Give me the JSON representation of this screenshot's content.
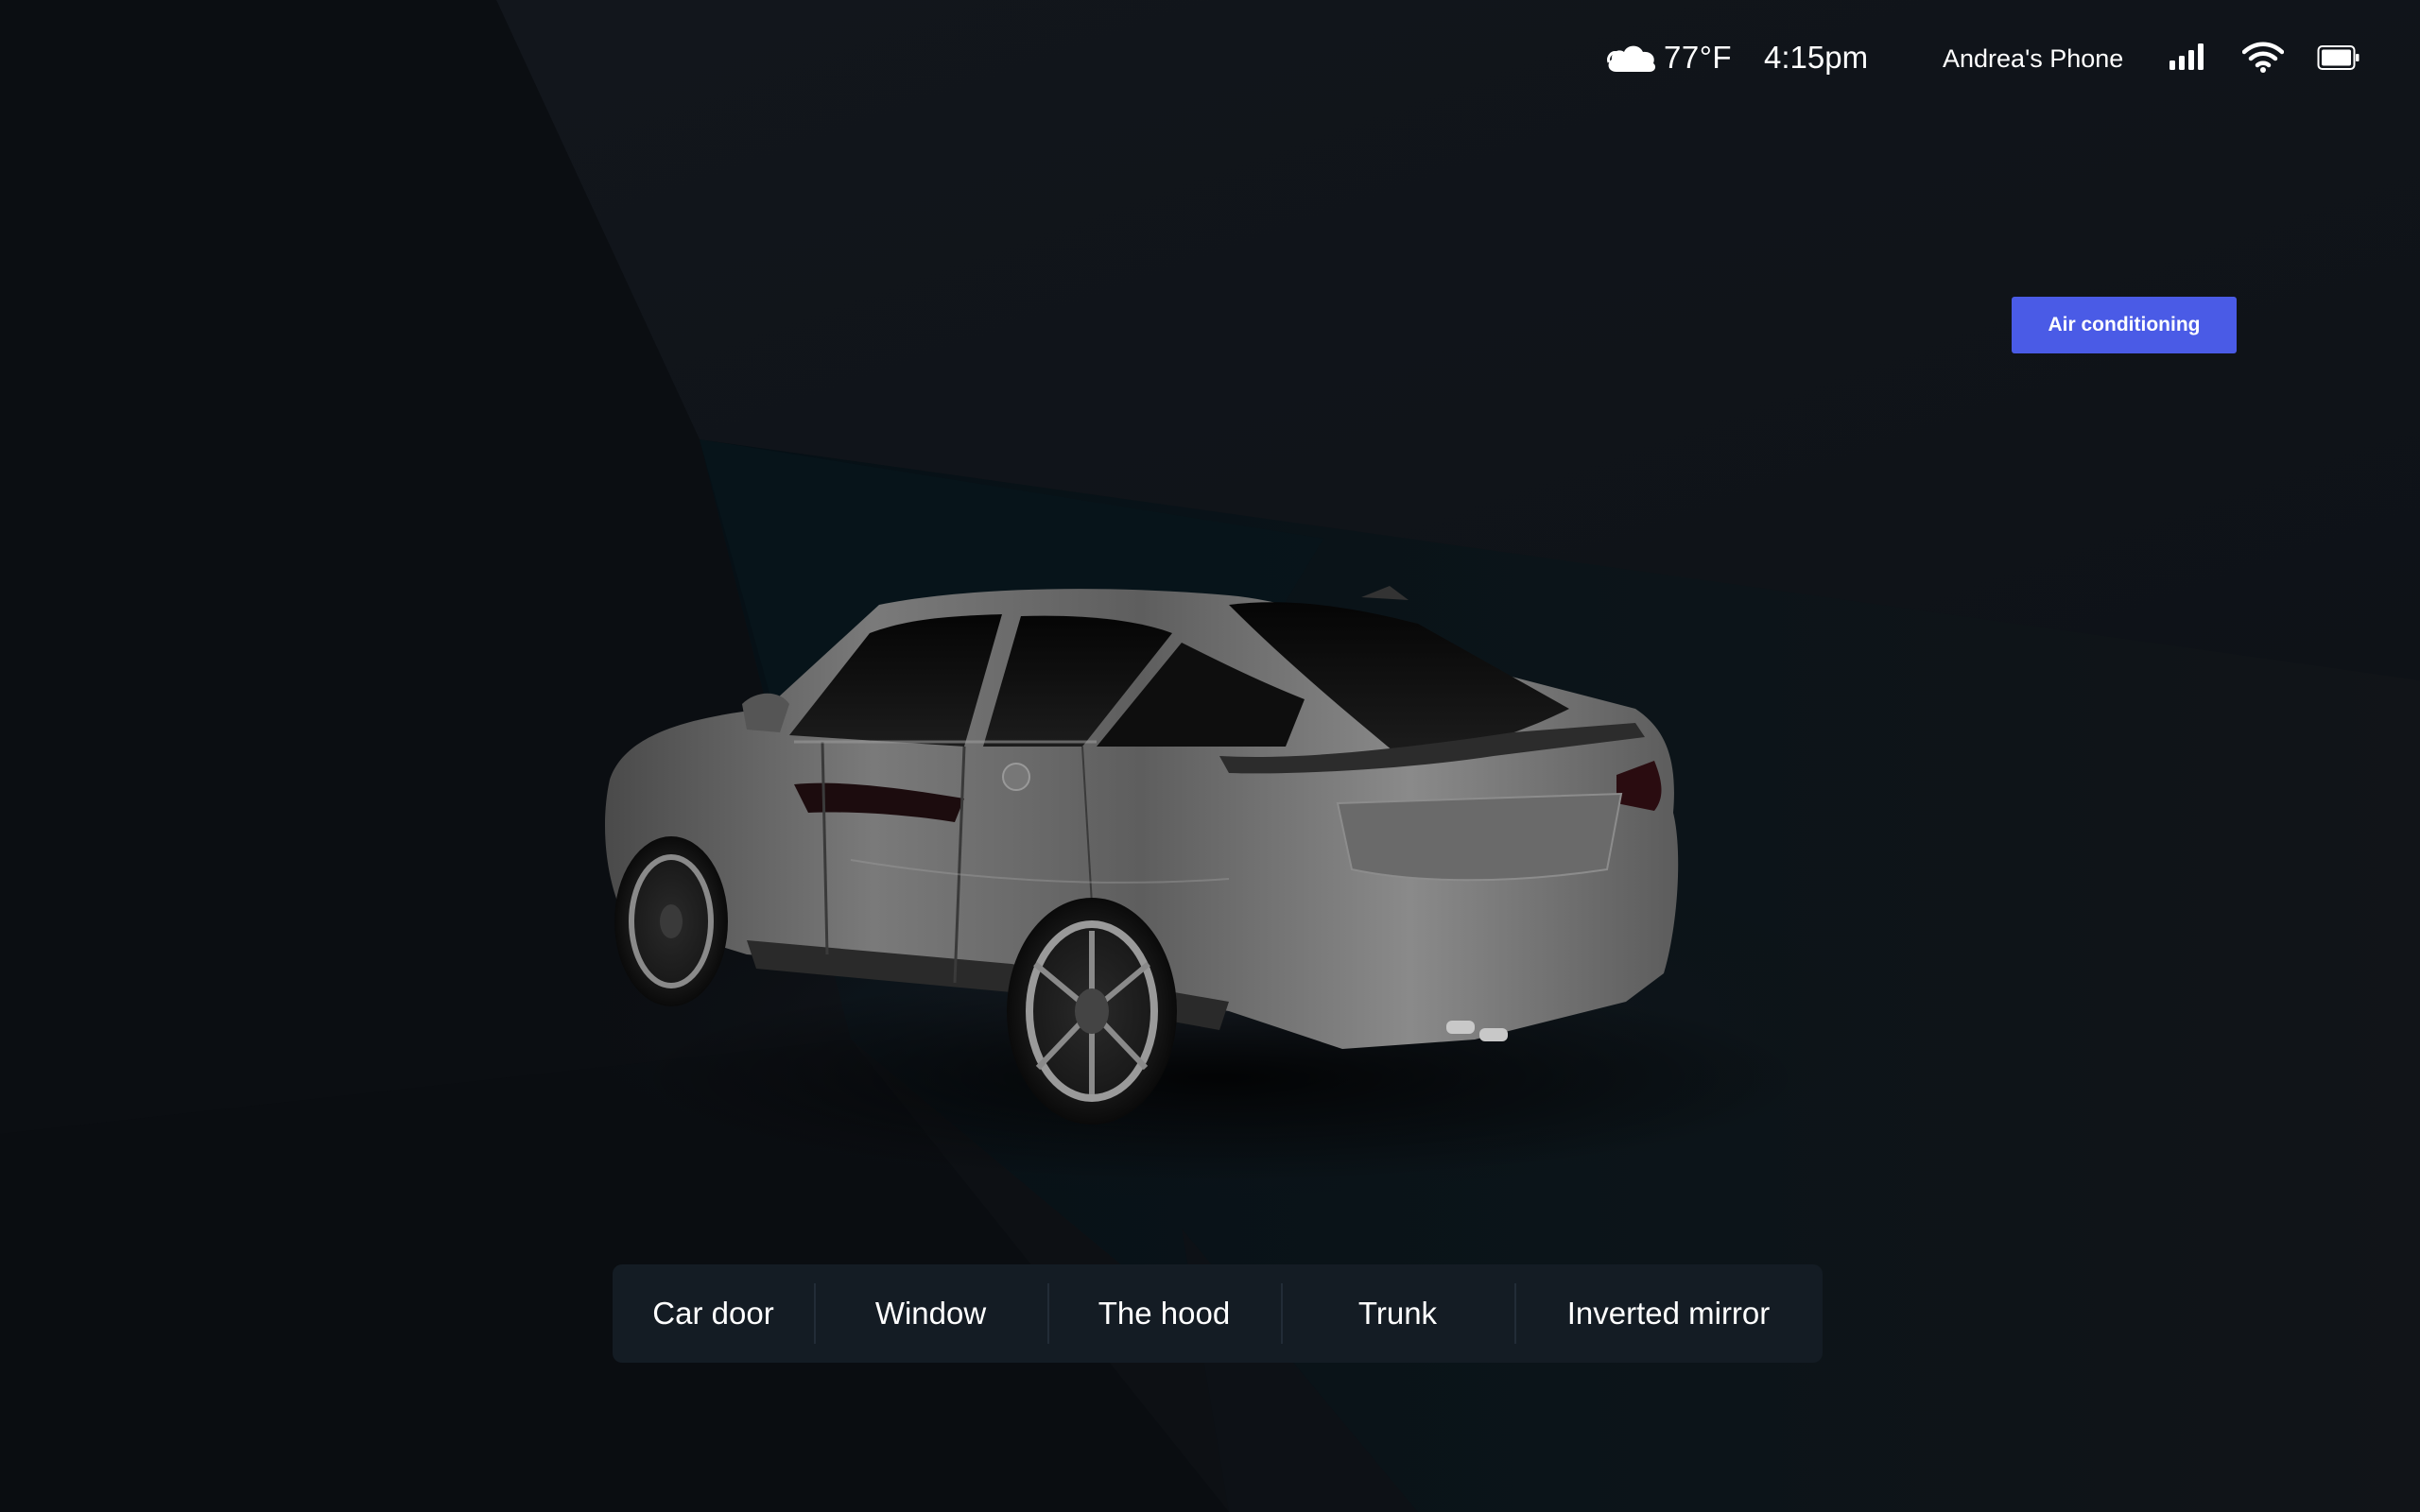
{
  "status_bar": {
    "weather_icon": "cloud-icon",
    "temperature": "77°F",
    "time": "4:15pm",
    "connected_device": "Andrea's Phone",
    "signal_icon": "cellular-signal-icon",
    "wifi_icon": "wifi-icon",
    "battery_icon": "battery-icon"
  },
  "climate": {
    "ac_button_label": "Air conditioning",
    "accent_color": "#4a5be6"
  },
  "vehicle": {
    "image": "car-rear-three-quarter-view",
    "color": "#6e6e6e"
  },
  "controls": {
    "items": [
      {
        "label": "Car door"
      },
      {
        "label": "Window"
      },
      {
        "label": "The hood"
      },
      {
        "label": "Trunk"
      },
      {
        "label": "Inverted mirror"
      }
    ]
  },
  "colors": {
    "background": "#0c0f13",
    "panel": "#141c24",
    "text": "#ffffff"
  }
}
